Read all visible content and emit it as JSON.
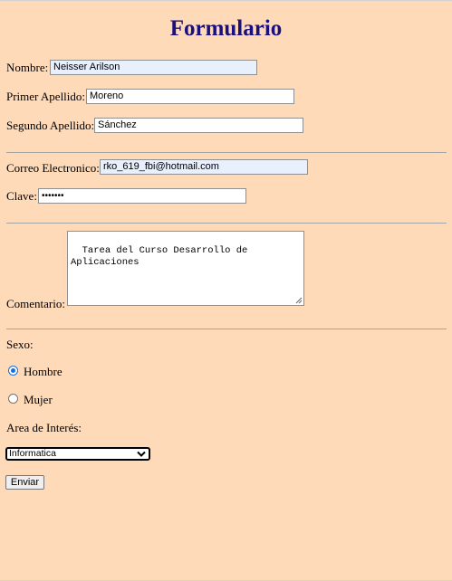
{
  "form": {
    "title": "Formulario",
    "nombre": {
      "label": "Nombre:",
      "value": "Neisser Arilson"
    },
    "primer_apellido": {
      "label": "Primer Apellido:",
      "value": "Moreno"
    },
    "segundo_apellido": {
      "label": "Segundo Apellido:",
      "value": "Sánchez"
    },
    "correo": {
      "label": "Correo Electronico:",
      "value": "rko_619_fbi@hotmail.com"
    },
    "clave": {
      "label": "Clave:",
      "value": "•••••••"
    },
    "comentario": {
      "label": "Comentario:",
      "value": "Tarea del Curso Desarrollo de Aplicaciones"
    },
    "sexo": {
      "label": "Sexo:",
      "options": [
        {
          "label": "Hombre",
          "checked": true
        },
        {
          "label": "Mujer",
          "checked": false
        }
      ]
    },
    "area": {
      "label": "Area de Interés:",
      "selected": "Informatica"
    },
    "submit_label": "Enviar"
  },
  "colors": {
    "background": "#ffdab9",
    "title": "#1a1080",
    "autofill": "#e8f0fe",
    "radio_accent": "#1a6fd8"
  }
}
